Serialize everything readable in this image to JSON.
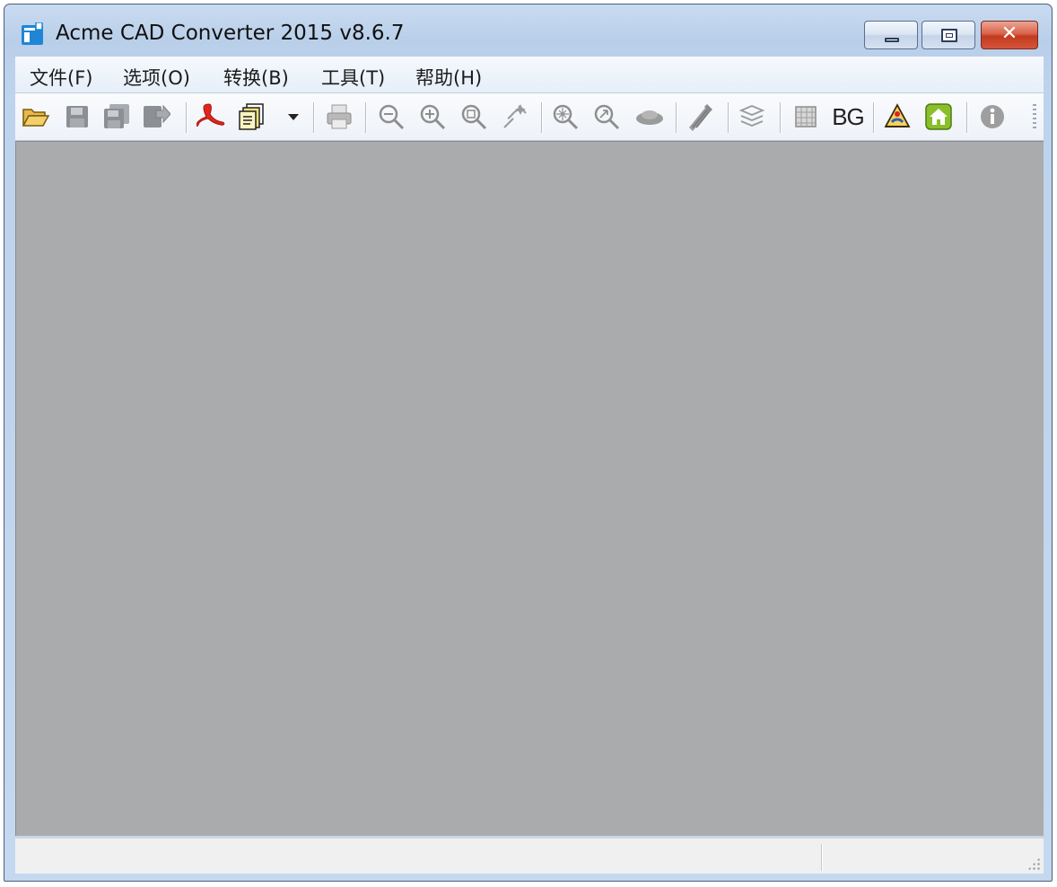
{
  "window": {
    "title": "Acme CAD Converter 2015 v8.6.7",
    "close_glyph": "✕"
  },
  "menu": [
    {
      "label": "文件(F)"
    },
    {
      "label": "选项(O)"
    },
    {
      "label": "转换(B)"
    },
    {
      "label": "工具(T)"
    },
    {
      "label": "帮助(H)"
    }
  ],
  "toolbar": {
    "bg_label": "BG",
    "icons": [
      "open-folder-icon",
      "save-icon",
      "save-all-icon",
      "export-icon",
      "pdf-icon",
      "batch-convert-icon",
      "print-icon",
      "zoom-out-icon",
      "zoom-in-icon",
      "zoom-window-icon",
      "zoom-pan-icon",
      "zoom-extents-icon",
      "zoom-previous-icon",
      "hide-icon",
      "pen-settings-icon",
      "layers-icon",
      "layout-icon",
      "help-book-icon",
      "home-icon",
      "info-icon"
    ]
  },
  "colors": {
    "canvas": "#aaabad",
    "title_bar": "#bed3ec",
    "close_button": "#c23a1f"
  }
}
